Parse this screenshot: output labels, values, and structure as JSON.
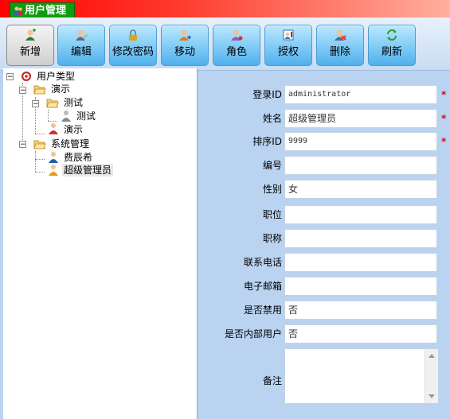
{
  "window": {
    "title": "用户管理"
  },
  "toolbar": {
    "buttons": [
      {
        "label": "新增",
        "icon": "add-user-icon"
      },
      {
        "label": "编辑",
        "icon": "edit-user-icon"
      },
      {
        "label": "修改密码",
        "icon": "lock-icon"
      },
      {
        "label": "移动",
        "icon": "move-user-icon"
      },
      {
        "label": "角色",
        "icon": "role-icon"
      },
      {
        "label": "授权",
        "icon": "authorize-icon"
      },
      {
        "label": "删除",
        "icon": "delete-user-icon"
      },
      {
        "label": "刷新",
        "icon": "refresh-icon"
      }
    ]
  },
  "tree": {
    "root": "用户类型",
    "group1": "演示",
    "subgroup": "测试",
    "user_test": "测试",
    "user_demo": "演示",
    "group2": "系统管理",
    "user_fei": "费辰希",
    "user_admin": "超级管理员"
  },
  "form": {
    "login_id": {
      "label": "登录ID",
      "value": "administrator",
      "required": true
    },
    "name": {
      "label": "姓名",
      "value": "超级管理员",
      "required": true
    },
    "sort_id": {
      "label": "排序ID",
      "value": "9999",
      "required": true
    },
    "number": {
      "label": "编号",
      "value": ""
    },
    "gender": {
      "label": "性别",
      "value": "女"
    },
    "position": {
      "label": "职位",
      "value": ""
    },
    "title": {
      "label": "职称",
      "value": ""
    },
    "phone": {
      "label": "联系电话",
      "value": ""
    },
    "email": {
      "label": "电子邮箱",
      "value": ""
    },
    "disabled": {
      "label": "是否禁用",
      "value": "否"
    },
    "internal": {
      "label": "是否内部用户",
      "value": "否"
    },
    "remark": {
      "label": "备注",
      "value": ""
    },
    "required_mark": "*"
  },
  "colors": {
    "title_tab": "#129b12",
    "required": "#ee0000",
    "button_blue": "#84cdf6"
  }
}
